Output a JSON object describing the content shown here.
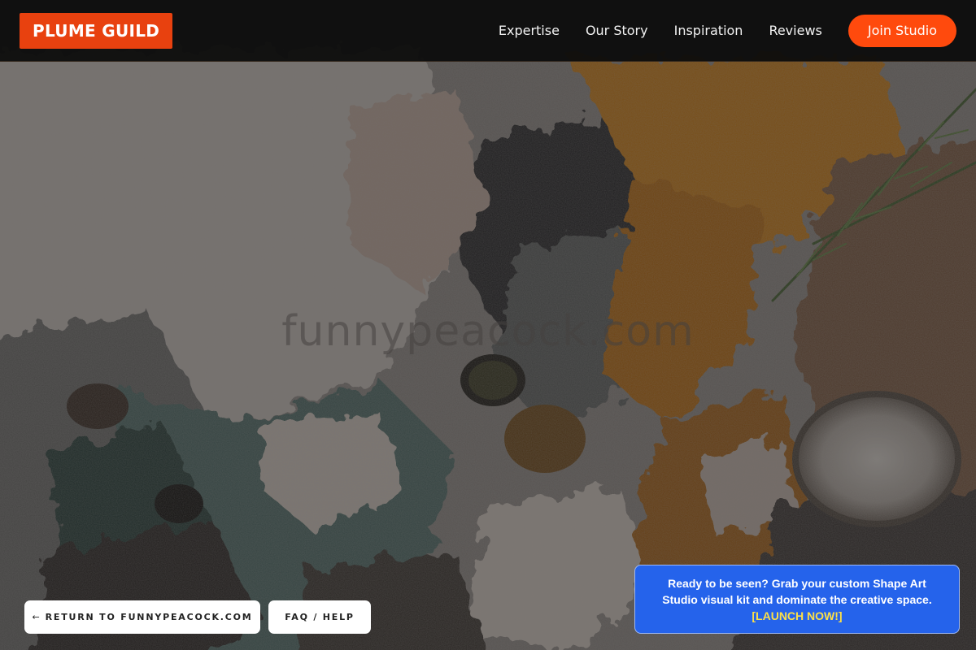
{
  "brand": {
    "name": "PLUME GUILD"
  },
  "nav": {
    "links": [
      "Expertise",
      "Our Story",
      "Inspiration",
      "Reviews"
    ],
    "cta_label": "Join Studio"
  },
  "watermark": "funnypeacock.com",
  "footer": {
    "return_arrow": "←",
    "return_label": "RETURN TO FUNNYPEACOCK.COM",
    "faq_label": "FAQ / HELP"
  },
  "promo": {
    "text": "Ready to be seen? Grab your custom Shape Art Studio visual kit and dominate the creative space.",
    "link_label": "[LAUNCH NOW!]"
  },
  "colors": {
    "brand_bg": "#e8410f",
    "cta_bg": "#ff4a0d",
    "promo_bg": "#2563eb",
    "promo_link": "#fde047",
    "navbar_bg": "#0c0c0c"
  }
}
